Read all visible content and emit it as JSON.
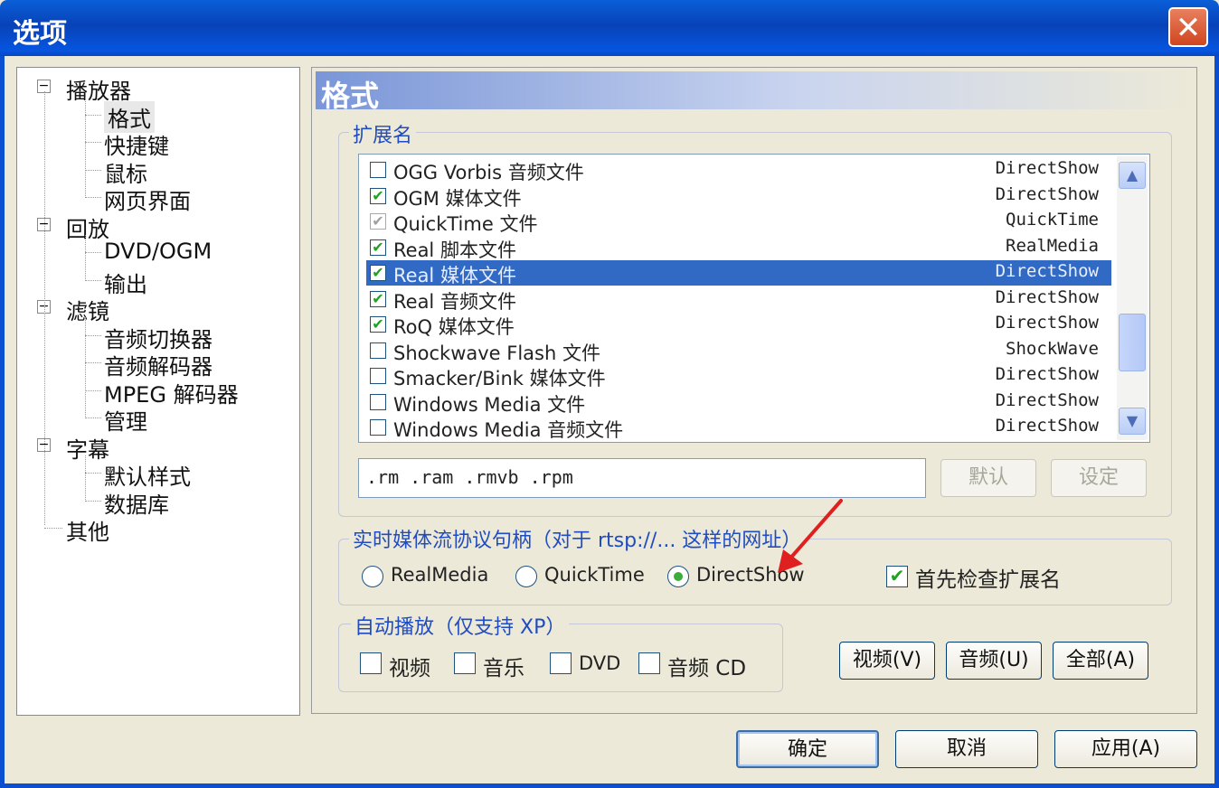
{
  "window": {
    "title": "选项",
    "close_glyph": "✕"
  },
  "tree": {
    "items": [
      {
        "label": "播放器",
        "level": 0,
        "expander": "−"
      },
      {
        "label": "格式",
        "level": 1,
        "selected": true
      },
      {
        "label": "快捷键",
        "level": 1
      },
      {
        "label": "鼠标",
        "level": 1
      },
      {
        "label": "网页界面",
        "level": 1
      },
      {
        "label": "回放",
        "level": 0,
        "expander": "−"
      },
      {
        "label": "DVD/OGM",
        "level": 1
      },
      {
        "label": "输出",
        "level": 1
      },
      {
        "label": "滤镜",
        "level": 0,
        "expander": "−"
      },
      {
        "label": "音频切换器",
        "level": 1
      },
      {
        "label": "音频解码器",
        "level": 1
      },
      {
        "label": "MPEG 解码器",
        "level": 1
      },
      {
        "label": "管理",
        "level": 1
      },
      {
        "label": "字幕",
        "level": 0,
        "expander": "−"
      },
      {
        "label": "默认样式",
        "level": 1
      },
      {
        "label": "数据库",
        "level": 1
      },
      {
        "label": "其他",
        "level": 0
      }
    ]
  },
  "panel": {
    "title": "格式"
  },
  "extensions": {
    "group_label": "扩展名",
    "rows": [
      {
        "name": "OGG Vorbis 音频文件",
        "handler": "DirectShow",
        "checked": false
      },
      {
        "name": "OGM 媒体文件",
        "handler": "DirectShow",
        "checked": true
      },
      {
        "name": "QuickTime 文件",
        "handler": "QuickTime",
        "checked": true,
        "grey": true
      },
      {
        "name": "Real 脚本文件",
        "handler": "RealMedia",
        "checked": true
      },
      {
        "name": "Real 媒体文件",
        "handler": "DirectShow",
        "checked": true,
        "selected": true
      },
      {
        "name": "Real 音频文件",
        "handler": "DirectShow",
        "checked": true
      },
      {
        "name": "RoQ 媒体文件",
        "handler": "DirectShow",
        "checked": true
      },
      {
        "name": "Shockwave Flash 文件",
        "handler": "ShockWave",
        "checked": false
      },
      {
        "name": "Smacker/Bink 媒体文件",
        "handler": "DirectShow",
        "checked": false
      },
      {
        "name": "Windows Media 文件",
        "handler": "DirectShow",
        "checked": false
      },
      {
        "name": "Windows Media 音频文件",
        "handler": "DirectShow",
        "checked": false
      }
    ],
    "ext_value": ".rm .ram .rmvb .rpm",
    "default_button": "默认",
    "set_button": "设定",
    "scroll_up": "▲",
    "scroll_down": "▼"
  },
  "streaming": {
    "group_label": "实时媒体流协议句柄（对于 rtsp://... 这样的网址）",
    "options": [
      "RealMedia",
      "QuickTime",
      "DirectShow"
    ],
    "selected": "DirectShow",
    "check_ext_label": "首先检查扩展名",
    "check_ext_checked": true
  },
  "autoplay": {
    "group_label": "自动播放（仅支持 XP）",
    "checks": [
      "视频",
      "音乐",
      "DVD",
      "音频 CD"
    ],
    "buttons": [
      "视频(V)",
      "音频(U)",
      "全部(A)"
    ]
  },
  "footer": {
    "ok": "确定",
    "cancel": "取消",
    "apply": "应用(A)"
  },
  "check_glyph": "✔",
  "colors": {
    "title_blue": "#0842b8",
    "selection": "#316ac5",
    "group_label": "#1f4cc2",
    "annotation_arrow": "#e02020"
  }
}
